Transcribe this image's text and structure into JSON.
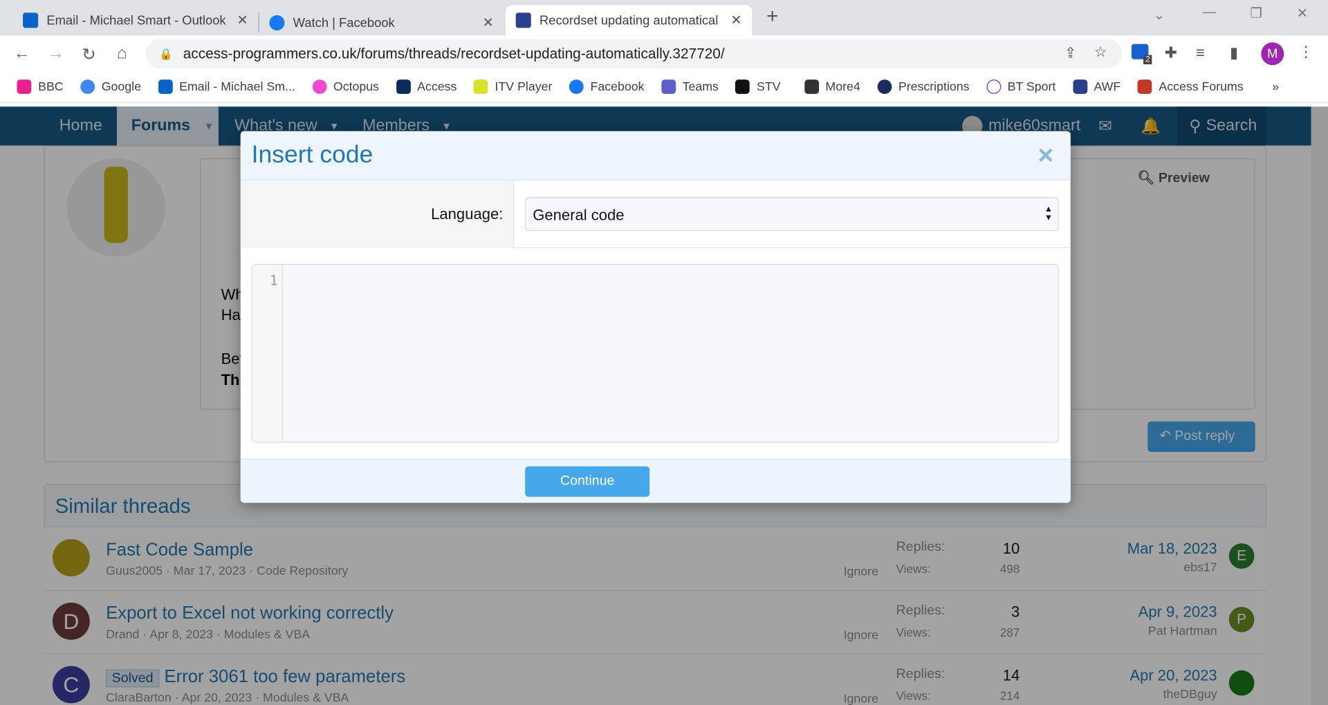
{
  "browser": {
    "tabs": [
      {
        "title": "Email - Michael Smart - Outlook"
      },
      {
        "title": "Watch | Facebook"
      },
      {
        "title": "Recordset updating automatically"
      }
    ],
    "url": "access-programmers.co.uk/forums/threads/recordset-updating-automatically.327720/",
    "extension_badge": "2",
    "profile_initial": "M",
    "bookmarks": [
      "BBC",
      "Google",
      "Email - Michael Sm...",
      "Octopus",
      "Access",
      "ITV Player",
      "Facebook",
      "Teams",
      "STV",
      "More4",
      "Prescriptions",
      "BT Sport",
      "AWF",
      "Access Forums"
    ],
    "more": "»"
  },
  "nav": {
    "home": "Home",
    "forums": "Forums",
    "whats_new": "What's new",
    "members": "Members",
    "user": "mike60smart",
    "search": "Search"
  },
  "editor": {
    "preview": "Preview",
    "post_reply": "Post reply",
    "partial_lines": [
      "Wh",
      "Ha",
      "Bef",
      "Thi"
    ]
  },
  "modal": {
    "title": "Insert code",
    "close": "×",
    "language_label": "Language:",
    "language_value": "General code",
    "line_number": "1",
    "continue": "Continue"
  },
  "similar": {
    "title": "Similar threads",
    "replies_label": "Replies:",
    "views_label": "Views:",
    "ignore": "Ignore",
    "threads": [
      {
        "title": "Fast Code Sample",
        "meta": "Guus2005 · Mar 17, 2023 · Code Repository",
        "replies": "10",
        "views": "498",
        "date": "Mar 18, 2023",
        "user": "ebs17",
        "avatar": "",
        "user_avatar": "E"
      },
      {
        "title": "Export to Excel not working correctly",
        "meta": "Drand · Apr 8, 2023 · Modules & VBA",
        "replies": "3",
        "views": "287",
        "date": "Apr 9, 2023",
        "user": "Pat Hartman",
        "avatar": "D",
        "user_avatar": "P"
      },
      {
        "badge": "Solved",
        "title": "Error 3061 too few parameters",
        "meta": "ClaraBarton · Apr 20, 2023 · Modules & VBA",
        "replies": "14",
        "views": "214",
        "date": "Apr 20, 2023",
        "user": "theDBguy",
        "avatar": "C",
        "user_avatar": ""
      }
    ]
  }
}
